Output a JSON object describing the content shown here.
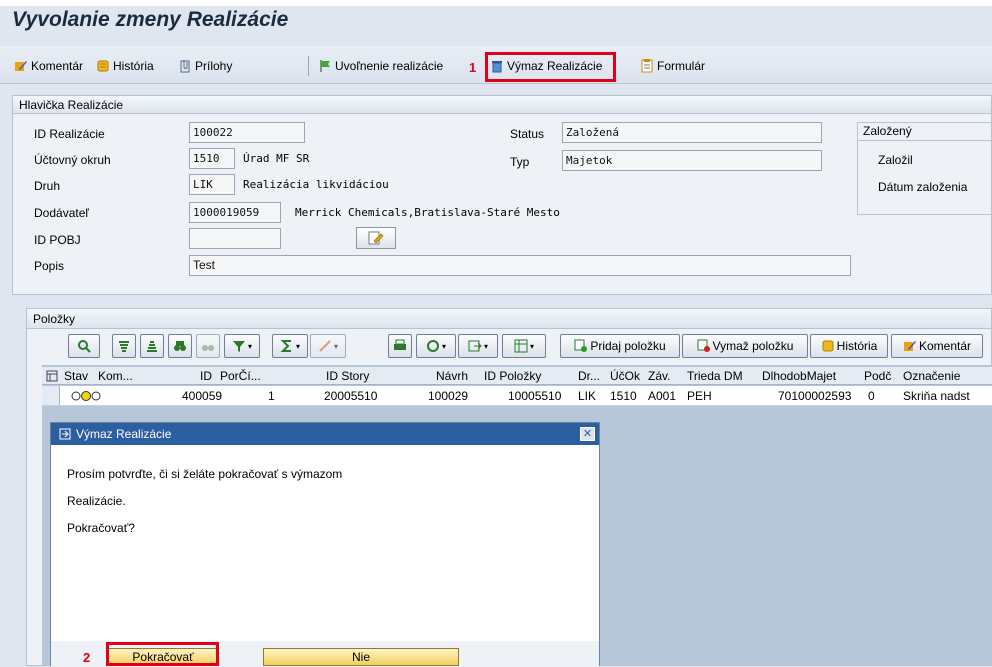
{
  "page": {
    "title": "Vyvolanie zmeny Realizácie"
  },
  "toolbar": {
    "komentar": "Komentár",
    "historia": "História",
    "prilohy": "Prílohy",
    "uvolnenie": "Uvoľnenie realizácie",
    "vymaz": "Výmaz Realizácie",
    "formular": "Formulár",
    "callout1": "1"
  },
  "header": {
    "section_title": "Hlavička Realizácie",
    "id_label": "ID Realizácie",
    "id_value": "100022",
    "okruh_label": "Účtovný okruh",
    "okruh_code": "1510",
    "okruh_name": "Úrad MF SR",
    "druh_label": "Druh",
    "druh_code": "LIK",
    "druh_name": "Realizácia likvidáciou",
    "dodavatel_label": "Dodávateľ",
    "dodavatel_code": "1000019059",
    "dodavatel_name": "Merrick Chemicals,Bratislava-Staré Mesto",
    "pobj_label": "ID POBJ",
    "pobj_value": "",
    "popis_label": "Popis",
    "popis_value": "Test",
    "status_label": "Status",
    "status_value": "Založená",
    "typ_label": "Typ",
    "typ_value": "Majetok",
    "zalozeny_title": "Založený",
    "zalozil_label": "Založil",
    "datum_label": "Dátum založenia"
  },
  "items": {
    "section_title": "Položky",
    "btn_pridaj": "Pridaj položku",
    "btn_vymaz": "Vymaž položku",
    "btn_historia": "História",
    "btn_komentar": "Komentár",
    "columns": [
      "Stav",
      "Kom...",
      "ID",
      "PorČí...",
      "ID Story",
      "Návrh",
      "ID Položky",
      "Dr...",
      "ÚčOk",
      "Záv.",
      "Trieda DM",
      "DlhodobMajet",
      "Podč",
      "Označenie"
    ],
    "rows": [
      [
        "400059",
        "1",
        "20005510",
        "100029",
        "10005510",
        "LIK",
        "1510",
        "A001",
        "PEH",
        "70100002593",
        "0",
        "Skriňa nadst"
      ]
    ]
  },
  "dialog": {
    "title": "Výmaz Realizácie",
    "line1": "Prosím potvrďte, či si želáte pokračovať s výmazom",
    "line2": "Realizácie.",
    "line3": "Pokračovať?",
    "btn_yes": "Pokračovať",
    "btn_no": "Nie",
    "callout2": "2"
  },
  "colors": {
    "accent_red": "#e0001a",
    "dialog_title": "#2c5fa0",
    "button_yellow": "#f4cf5f"
  }
}
